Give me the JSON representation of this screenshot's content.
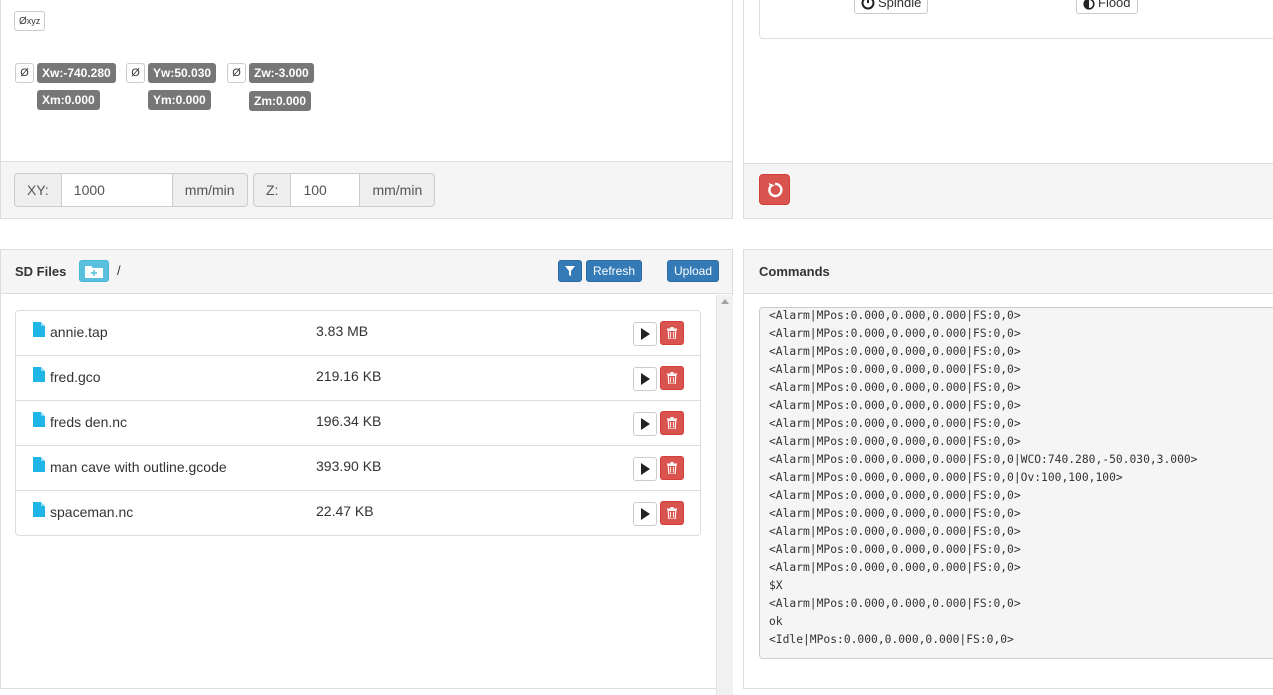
{
  "position": {
    "zero_all_label": "Ø",
    "zero_all_sub": "xyz",
    "zero_symbol": "Ø",
    "x_work": "Xw:-740.280",
    "y_work": "Yw:50.030",
    "z_work": "Zw:-3.000",
    "x_machine": "Xm:0.000",
    "y_machine": "Ym:0.000",
    "z_machine": "Zm:0.000"
  },
  "feed": {
    "xy_label": "XY:",
    "xy_value": "1000",
    "xy_unit": "mm/min",
    "z_label": "Z:",
    "z_value": "100",
    "z_unit": "mm/min"
  },
  "controls": {
    "spindle_label": "Spindle",
    "flood_label": "Flood"
  },
  "sd": {
    "title": "SD Files",
    "path": "/",
    "refresh_label": "Refresh",
    "upload_label": "Upload",
    "files": [
      {
        "name": "annie.tap",
        "size": "3.83 MB"
      },
      {
        "name": "fred.gco",
        "size": "219.16 KB"
      },
      {
        "name": "freds den.nc",
        "size": "196.34 KB"
      },
      {
        "name": "man cave with outline.gcode",
        "size": "393.90 KB"
      },
      {
        "name": "spaceman.nc",
        "size": "22.47 KB"
      }
    ]
  },
  "commands": {
    "title": "Commands",
    "lines": [
      "<Alarm|MPos:0.000,0.000,0.000|FS:0,0>",
      "<Alarm|MPos:0.000,0.000,0.000|FS:0,0>",
      "<Alarm|MPos:0.000,0.000,0.000|FS:0,0>",
      "<Alarm|MPos:0.000,0.000,0.000|FS:0,0>",
      "<Alarm|MPos:0.000,0.000,0.000|FS:0,0>",
      "<Alarm|MPos:0.000,0.000,0.000|FS:0,0>",
      "<Alarm|MPos:0.000,0.000,0.000|FS:0,0>",
      "<Alarm|MPos:0.000,0.000,0.000|FS:0,0>",
      "<Alarm|MPos:0.000,0.000,0.000|FS:0,0|WCO:740.280,-50.030,3.000>",
      "<Alarm|MPos:0.000,0.000,0.000|FS:0,0|Ov:100,100,100>",
      "<Alarm|MPos:0.000,0.000,0.000|FS:0,0>",
      "<Alarm|MPos:0.000,0.000,0.000|FS:0,0>",
      "<Alarm|MPos:0.000,0.000,0.000|FS:0,0>",
      "<Alarm|MPos:0.000,0.000,0.000|FS:0,0>",
      "<Alarm|MPos:0.000,0.000,0.000|FS:0,0>",
      "$X",
      "<Alarm|MPos:0.000,0.000,0.000|FS:0,0>",
      "ok",
      "<Idle|MPos:0.000,0.000,0.000|FS:0,0>"
    ]
  },
  "colors": {
    "primary": "#337ab7",
    "info": "#5bc0de",
    "danger": "#d9534f",
    "label": "#777777",
    "file_icon": "#1fb5e6"
  }
}
